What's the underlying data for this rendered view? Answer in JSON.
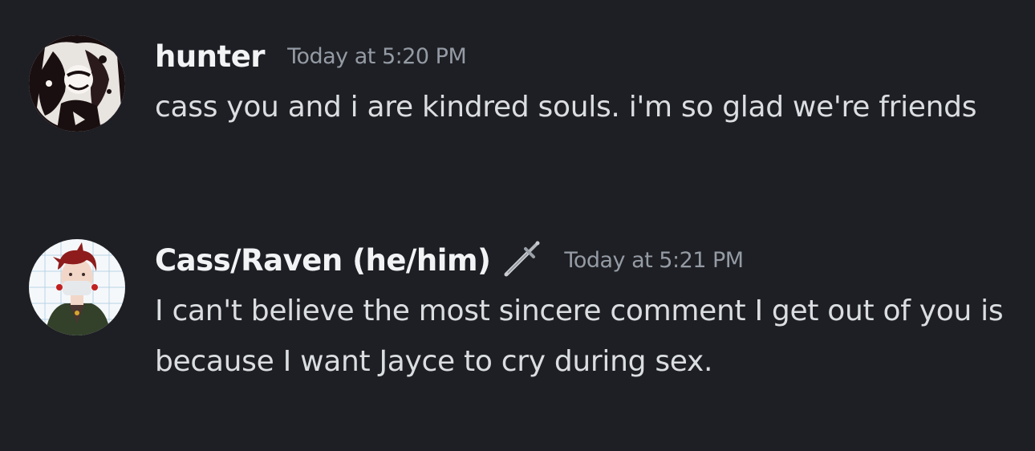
{
  "messages": [
    {
      "username": "hunter",
      "timestamp": "Today at 5:20 PM",
      "text": "cass you and i are kindred souls. i'm so glad we're friends",
      "avatar_icon": "bw-illustrated-avatar"
    },
    {
      "username": "Cass/Raven (he/him)",
      "role_icon": "dagger-icon",
      "timestamp": "Today at 5:21 PM",
      "text": "I can't believe the most sincere comment I get out of you is because I want Jayce to cry during sex.",
      "avatar_icon": "red-haired-character-avatar"
    }
  ],
  "colors": {
    "background": "#1e1f24",
    "username": "#f2f3f5",
    "timestamp": "#949ba4",
    "message_text": "#dbdee1"
  }
}
